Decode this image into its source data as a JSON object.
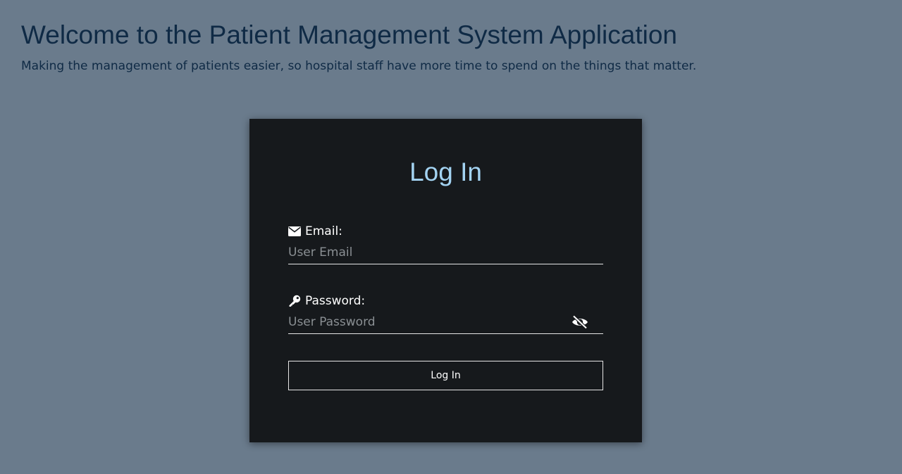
{
  "header": {
    "title": "Welcome to the Patient Management System Application",
    "subtitle": "Making the management of patients easier, so hospital staff have more time to spend on the things that matter."
  },
  "login_card": {
    "title": "Log In",
    "email": {
      "label": "Email:",
      "placeholder": "User Email",
      "value": "",
      "icon": "envelope-icon"
    },
    "password": {
      "label": "Password:",
      "placeholder": "User Password",
      "value": "",
      "icon": "key-icon",
      "toggle_icon": "eye-slash-icon"
    },
    "submit_label": "Log In"
  },
  "colors": {
    "page_background": "#6a7b8c",
    "heading_text": "#0f2a45",
    "card_background": "#16191c",
    "card_title": "#a3d3f2",
    "card_text": "#ffffff"
  }
}
